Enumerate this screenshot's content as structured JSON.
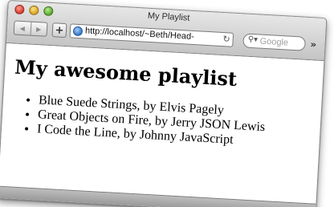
{
  "window": {
    "title": "My Playlist"
  },
  "toolbar": {
    "back_icon": "back-arrow-icon",
    "forward_icon": "forward-arrow-icon",
    "add_label": "+",
    "url": "http://localhost/~Beth/Head-",
    "reload_icon": "reload-icon",
    "search_placeholder": "Google",
    "overflow_label": "»"
  },
  "page": {
    "heading": "My awesome playlist",
    "playlist": [
      "Blue Suede Strings, by Elvis Pagely",
      "Great Objects on Fire, by Jerry JSON Lewis",
      "I Code the Line, by Johnny JavaScript"
    ]
  },
  "colors": {
    "close": "#d9382c",
    "minimize": "#d8a21e",
    "maximize": "#56a72c",
    "chrome": "#c4c4c4"
  }
}
